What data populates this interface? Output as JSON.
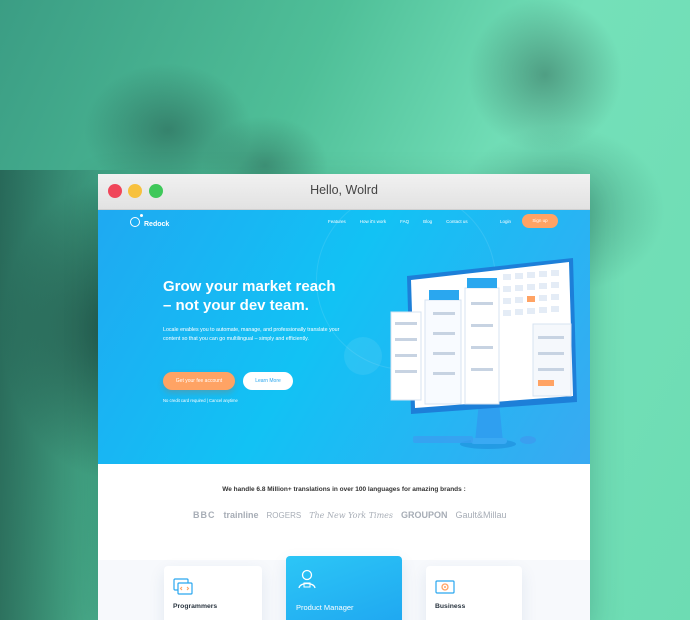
{
  "window": {
    "title": "Hello, Wolrd"
  },
  "nav": {
    "brand": "Redock",
    "links": [
      "Features",
      "How it's work",
      "FAQ",
      "Blog",
      "Contact us"
    ],
    "login": "Login",
    "signup": "Sign up"
  },
  "hero": {
    "headline_line1": "Grow your market reach",
    "headline_line2": "– not your dev team.",
    "subtitle": "Locale enables you to automate, manage, and professionally translate your content so that you can go multilingual – simply and efficiently.",
    "primary_button": "Get your fee account",
    "secondary_button": "Learn More",
    "fine_print": "No credit card required | Cancel anytime"
  },
  "clients": {
    "heading": "We handle 6.8 Million+ translations in over 100 languages for amazing brands :",
    "logos": [
      "BBC",
      "trainline",
      "ROGERS",
      "The New York Times",
      "GROUPON",
      "Gault&Millau"
    ]
  },
  "cards": [
    {
      "label": "Programmers",
      "icon": "code-window-icon"
    },
    {
      "label": "Product Manager",
      "icon": "manager-person-icon"
    },
    {
      "label": "Business",
      "icon": "business-gear-icon"
    }
  ],
  "colors": {
    "background": "#63d6ac",
    "hero_blue": "#1fa9f2",
    "accent_orange": "#ffa364",
    "mac_red": "#f0465a",
    "mac_yellow": "#f7c13e",
    "mac_green": "#3ec85a"
  }
}
